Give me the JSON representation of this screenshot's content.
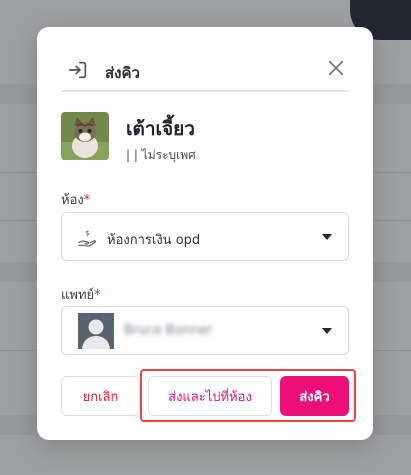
{
  "modal": {
    "title": "ส่งคิว",
    "icons": {
      "header": "login-icon",
      "close": "close-icon"
    }
  },
  "patient": {
    "name": "เต้าเจี้ยว",
    "sub": "| | ไม่ระบุเพศ"
  },
  "room_field": {
    "label": "ห้อง",
    "required_mark": "*",
    "selected_value": "ห้องการเงิน opd",
    "icon": "money-hand-icon"
  },
  "doctor_field": {
    "label": "แพทย์",
    "required_mark": "*",
    "selected_value": "Bruce Bonner"
  },
  "buttons": {
    "cancel": "ยกเลิก",
    "send_and_go": "ส่งและไปที่ห้อง",
    "send": "ส่งคิว"
  },
  "colors": {
    "primary": "#ec0f78",
    "danger": "#d9203a",
    "required": "#e0242f",
    "highlight_frame": "#e1474c"
  }
}
